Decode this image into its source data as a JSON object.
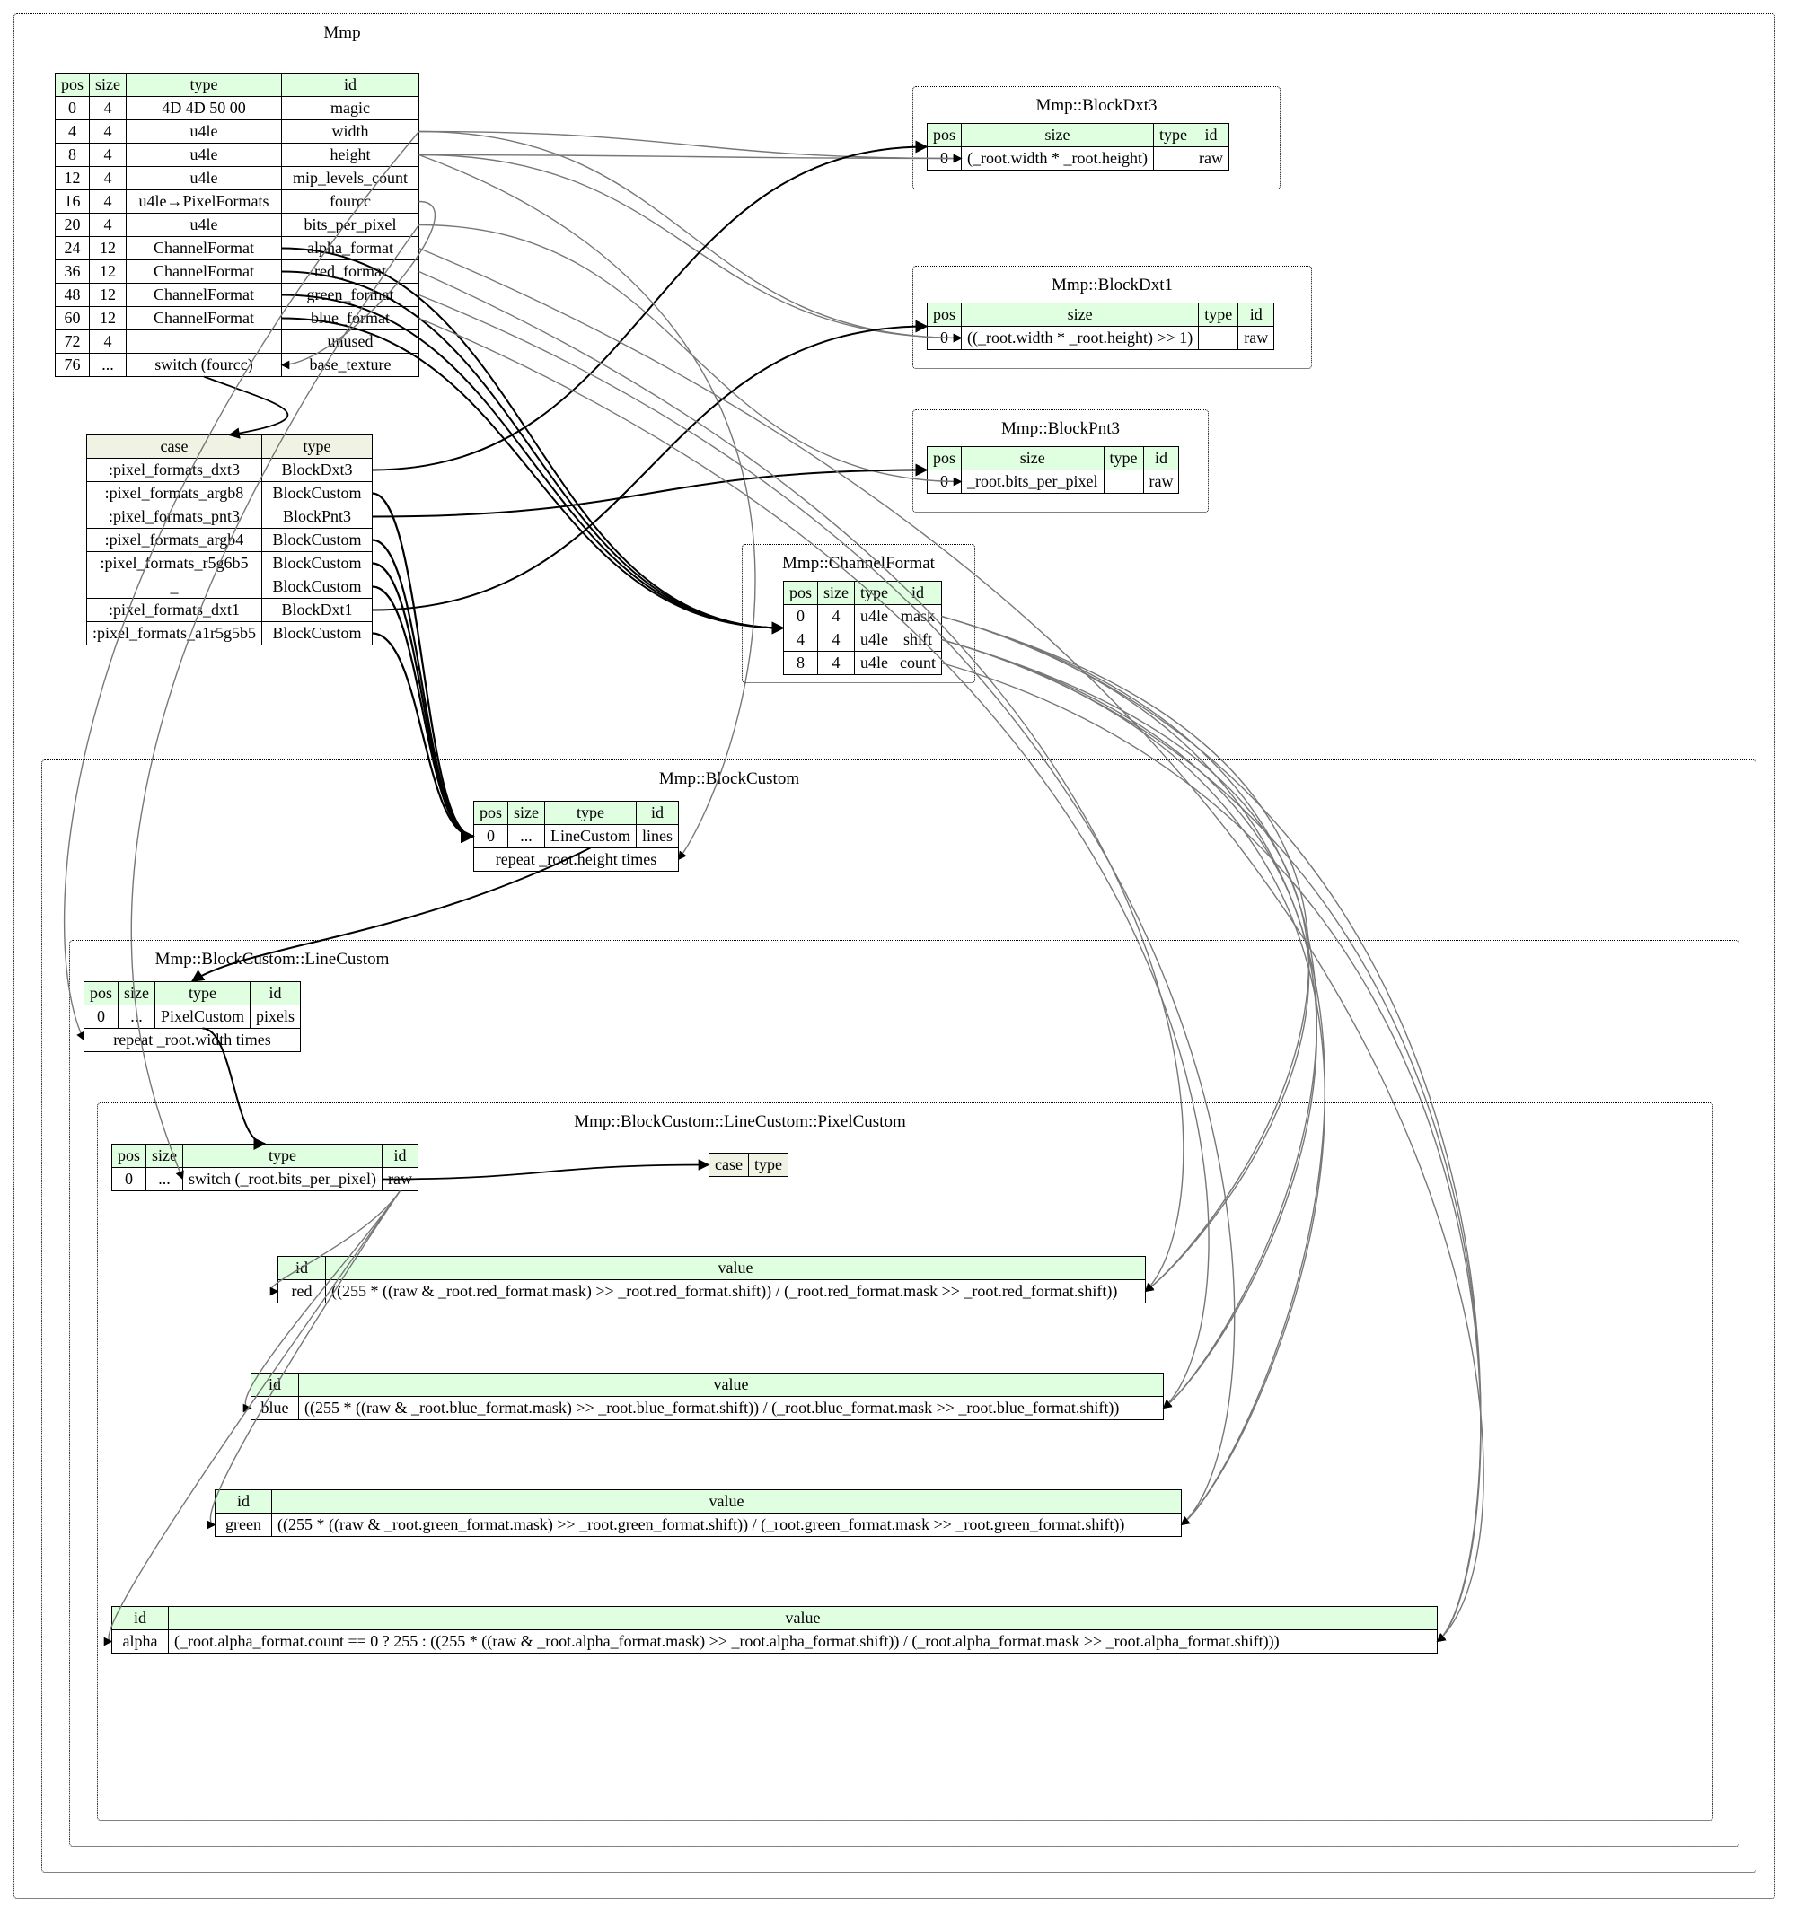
{
  "clusters": {
    "mmp": "Mmp",
    "dxt3": "Mmp::BlockDxt3",
    "dxt1": "Mmp::BlockDxt1",
    "pnt3": "Mmp::BlockPnt3",
    "chfmt": "Mmp::ChannelFormat",
    "bcustom": "Mmp::BlockCustom",
    "lcustom": "Mmp::BlockCustom::LineCustom",
    "pcustom": "Mmp::BlockCustom::LineCustom::PixelCustom"
  },
  "mmp_headers": [
    "pos",
    "size",
    "type",
    "id"
  ],
  "mmp_rows": [
    [
      "0",
      "4",
      "4D 4D 50 00",
      "magic"
    ],
    [
      "4",
      "4",
      "u4le",
      "width"
    ],
    [
      "8",
      "4",
      "u4le",
      "height"
    ],
    [
      "12",
      "4",
      "u4le",
      "mip_levels_count"
    ],
    [
      "16",
      "4",
      "u4le→PixelFormats",
      "fourcc"
    ],
    [
      "20",
      "4",
      "u4le",
      "bits_per_pixel"
    ],
    [
      "24",
      "12",
      "ChannelFormat",
      "alpha_format"
    ],
    [
      "36",
      "12",
      "ChannelFormat",
      "red_format"
    ],
    [
      "48",
      "12",
      "ChannelFormat",
      "green_format"
    ],
    [
      "60",
      "12",
      "ChannelFormat",
      "blue_format"
    ],
    [
      "72",
      "4",
      "",
      "unused"
    ],
    [
      "76",
      "...",
      "switch (fourcc)",
      "base_texture"
    ]
  ],
  "switch_headers": [
    "case",
    "type"
  ],
  "switch_rows": [
    [
      ":pixel_formats_dxt3",
      "BlockDxt3"
    ],
    [
      ":pixel_formats_argb8",
      "BlockCustom"
    ],
    [
      ":pixel_formats_pnt3",
      "BlockPnt3"
    ],
    [
      ":pixel_formats_argb4",
      "BlockCustom"
    ],
    [
      ":pixel_formats_r5g6b5",
      "BlockCustom"
    ],
    [
      "_",
      "BlockCustom"
    ],
    [
      ":pixel_formats_dxt1",
      "BlockDxt1"
    ],
    [
      ":pixel_formats_a1r5g5b5",
      "BlockCustom"
    ]
  ],
  "dxt3": {
    "h": [
      "pos",
      "size",
      "type",
      "id"
    ],
    "r": [
      "0",
      "(_root.width * _root.height)",
      "",
      "raw"
    ]
  },
  "dxt1": {
    "h": [
      "pos",
      "size",
      "type",
      "id"
    ],
    "r": [
      "0",
      "((_root.width * _root.height) >> 1)",
      "",
      "raw"
    ]
  },
  "pnt3": {
    "h": [
      "pos",
      "size",
      "type",
      "id"
    ],
    "r": [
      "0",
      "_root.bits_per_pixel",
      "",
      "raw"
    ]
  },
  "chfmt": {
    "h": [
      "pos",
      "size",
      "type",
      "id"
    ],
    "r": [
      [
        "0",
        "4",
        "u4le",
        "mask"
      ],
      [
        "4",
        "4",
        "u4le",
        "shift"
      ],
      [
        "8",
        "4",
        "u4le",
        "count"
      ]
    ]
  },
  "bcustom": {
    "h": [
      "pos",
      "size",
      "type",
      "id"
    ],
    "r": [
      "0",
      "...",
      "LineCustom",
      "lines"
    ],
    "rep": "repeat _root.height times"
  },
  "lcustom": {
    "h": [
      "pos",
      "size",
      "type",
      "id"
    ],
    "r": [
      "0",
      "...",
      "PixelCustom",
      "pixels"
    ],
    "rep": "repeat _root.width times"
  },
  "pcustom_main": {
    "h": [
      "pos",
      "size",
      "type",
      "id"
    ],
    "r": [
      "0",
      "...",
      "switch (_root.bits_per_pixel)",
      "raw"
    ]
  },
  "pcustom_case": {
    "h": [
      "case",
      "type"
    ]
  },
  "pc_red": {
    "id": "red",
    "val": "((255 * ((raw & _root.red_format.mask) >> _root.red_format.shift)) / (_root.red_format.mask >> _root.red_format.shift))"
  },
  "pc_blue": {
    "id": "blue",
    "val": "((255 * ((raw & _root.blue_format.mask) >> _root.blue_format.shift)) / (_root.blue_format.mask >> _root.blue_format.shift))"
  },
  "pc_green": {
    "id": "green",
    "val": "((255 * ((raw & _root.green_format.mask) >> _root.green_format.shift)) / (_root.green_format.mask >> _root.green_format.shift))"
  },
  "pc_alpha": {
    "id": "alpha",
    "val": "(_root.alpha_format.count == 0 ? 255 : ((255 * ((raw & _root.alpha_format.mask) >> _root.alpha_format.shift)) / (_root.alpha_format.mask >> _root.alpha_format.shift)))"
  }
}
